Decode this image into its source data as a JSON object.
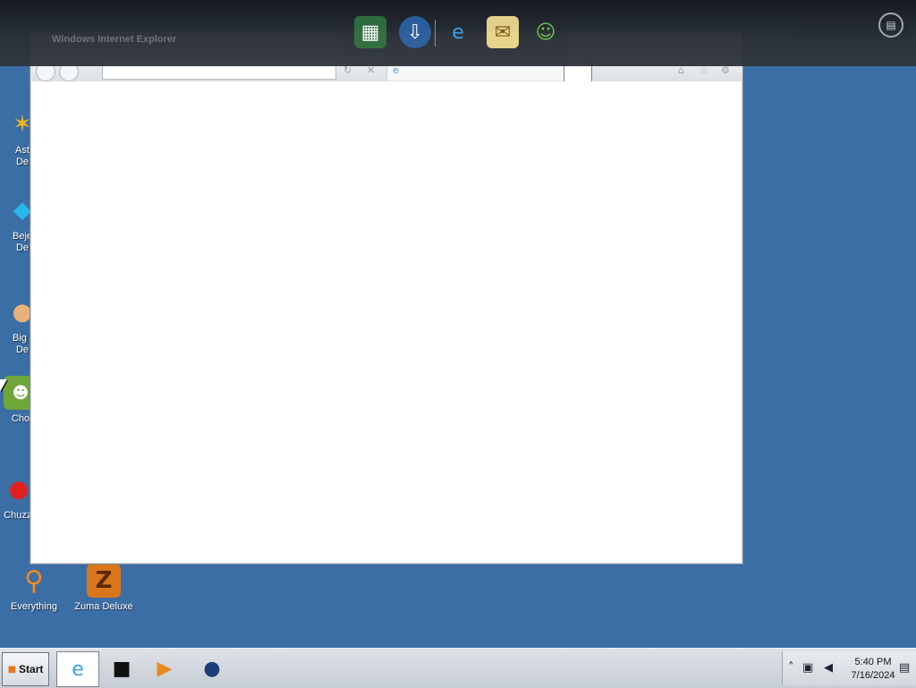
{
  "window": {
    "title": "Windows Internet Explorer"
  },
  "desktop_icons": [
    {
      "label": "Ast\nDe",
      "icon": "star-icon"
    },
    {
      "label": "Beje\nDe",
      "icon": "gem-icon"
    },
    {
      "label": "Big I\nDe",
      "icon": "fish-icon"
    },
    {
      "label": "Cho",
      "icon": "game-icon"
    },
    {
      "label": "Chuzzl",
      "icon": "chuzzle-icon"
    },
    {
      "label": "Everything",
      "icon": "magnifier-icon"
    },
    {
      "label": "Zuma Deluxe",
      "icon": "zuma-icon"
    }
  ],
  "dock_icons": [
    "app-cube-icon",
    "globe-download-icon",
    "internet-explorer-icon",
    "mail-icon",
    "messenger-icon"
  ],
  "taskbar": {
    "start_label": "Start",
    "buttons": [
      "internet-explorer-icon",
      "media-box-icon",
      "media-player-icon",
      "globe-icon"
    ]
  },
  "tray": {
    "time": "5:40 PM",
    "date": "7/16/2024"
  },
  "colors": {
    "desktop": "#3b6ea5",
    "taskbar": "#d3d8de",
    "dock": "#23272d"
  }
}
